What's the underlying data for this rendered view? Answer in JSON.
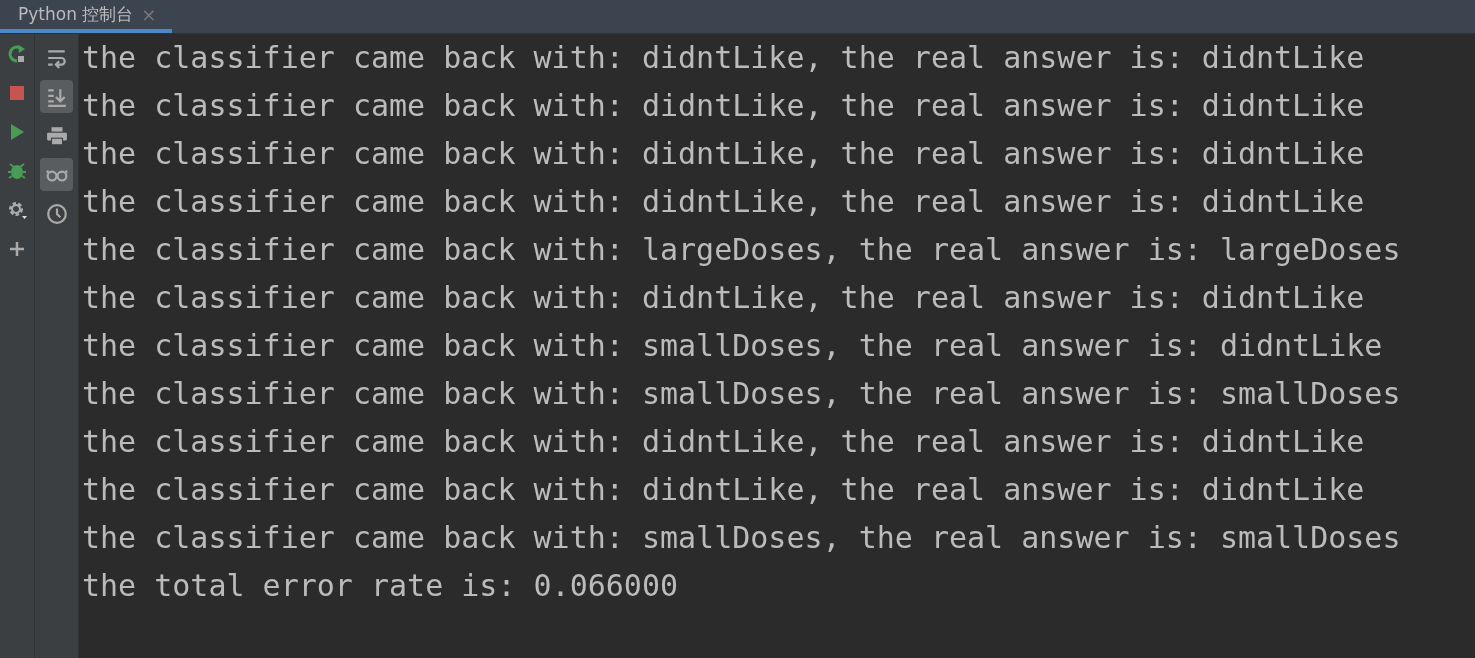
{
  "tab": {
    "title": "Python 控制台",
    "close": "×",
    "selected": true
  },
  "left_toolbar": [
    {
      "kind": "rerun"
    },
    {
      "kind": "stop"
    },
    {
      "kind": "run"
    },
    {
      "kind": "debug"
    },
    {
      "kind": "settings"
    },
    {
      "kind": "add"
    }
  ],
  "right_toolbar": [
    {
      "kind": "wrap",
      "on": false
    },
    {
      "kind": "scroll-end",
      "on": true
    },
    {
      "kind": "print",
      "on": false
    },
    {
      "kind": "glasses",
      "on": true
    },
    {
      "kind": "history",
      "on": false
    }
  ],
  "output": [
    "the classifier came back with: didntLike, the real answer is: didntLike",
    "the classifier came back with: didntLike, the real answer is: didntLike",
    "the classifier came back with: didntLike, the real answer is: didntLike",
    "the classifier came back with: didntLike, the real answer is: didntLike",
    "the classifier came back with: largeDoses, the real answer is: largeDoses",
    "the classifier came back with: didntLike, the real answer is: didntLike",
    "the classifier came back with: smallDoses, the real answer is: didntLike",
    "the classifier came back with: smallDoses, the real answer is: smallDoses",
    "the classifier came back with: didntLike, the real answer is: didntLike",
    "the classifier came back with: didntLike, the real answer is: didntLike",
    "the classifier came back with: smallDoses, the real answer is: smallDoses",
    "the total error rate is: 0.066000"
  ]
}
